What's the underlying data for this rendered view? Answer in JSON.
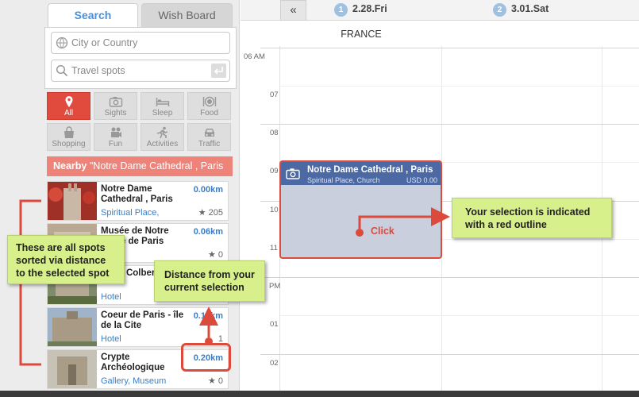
{
  "sidebar": {
    "tabs": {
      "search": "Search",
      "wish_board": "Wish Board"
    },
    "city_placeholder": "City or Country",
    "spots_placeholder": "Travel spots",
    "categories": [
      {
        "label": "All",
        "icon": "pin-icon"
      },
      {
        "label": "Sights",
        "icon": "camera-icon"
      },
      {
        "label": "Sleep",
        "icon": "bed-icon"
      },
      {
        "label": "Food",
        "icon": "plate-icon"
      },
      {
        "label": "Shopping",
        "icon": "bag-icon"
      },
      {
        "label": "Fun",
        "icon": "film-icon"
      },
      {
        "label": "Activities",
        "icon": "runner-icon"
      },
      {
        "label": "Traffic",
        "icon": "car-icon"
      }
    ],
    "nearby_label": "Nearby",
    "nearby_value": "\"Notre Dame Cathedral , Paris",
    "spots": [
      {
        "name": "Notre Dame Cathedral , Paris",
        "distance": "0.00km",
        "category": "Spiritual Place,",
        "rating": "★ 205"
      },
      {
        "name": "Musée de Notre Dame de Paris",
        "distance": "0.06km",
        "category": "",
        "rating": "★ 0"
      },
      {
        "name": "Hôtel Colbert",
        "distance": "",
        "category": "Hotel",
        "rating": ""
      },
      {
        "name": "Coeur de Paris - île de la Cite",
        "distance": "0.18km",
        "category": "Hotel",
        "rating": "1"
      },
      {
        "name": "Crypte Archéologique",
        "distance": "0.20km",
        "category": "Gallery, Museum",
        "rating": "★ 0"
      }
    ]
  },
  "calendar": {
    "collapse_label": "«",
    "days": [
      {
        "num": "1",
        "label": "2.28.Fri"
      },
      {
        "num": "2",
        "label": "3.01.Sat"
      }
    ],
    "region": "FRANCE",
    "times": [
      "06 AM",
      "07",
      "08",
      "09",
      "10",
      "11",
      "PM",
      "01",
      "02"
    ],
    "event": {
      "title": "Notre Dame Cathedral , Paris",
      "subtitle": "Spiritual Place, Church",
      "price": "USD 0.00"
    }
  },
  "annotations": {
    "spots_note": "These are all spots sorted via distance to the selected spot",
    "distance_note": "Distance from your current selection",
    "selection_note": "Your selection is indicated with a red outline",
    "click_label": "Click"
  },
  "colors": {
    "accent_red": "#dc4a3b",
    "callout_green": "#d8f08b",
    "event_blue": "#4c69a3",
    "link_blue": "#3b7ec5"
  }
}
